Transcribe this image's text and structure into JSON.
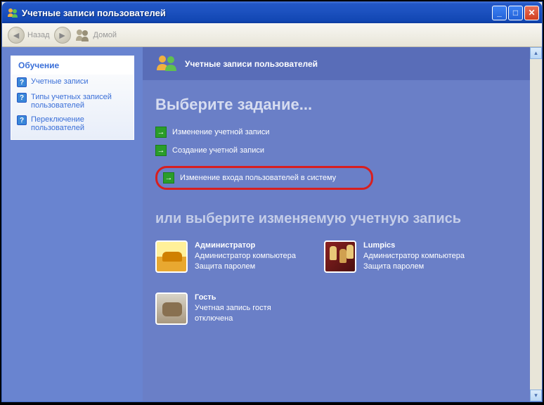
{
  "window": {
    "title": "Учетные записи пользователей"
  },
  "toolbar": {
    "back": "Назад",
    "home": "Домой"
  },
  "sidebar": {
    "header": "Обучение",
    "items": [
      "Учетные записи",
      "Типы учетных записей пользователей",
      "Переключение пользователей"
    ]
  },
  "main": {
    "header": "Учетные записи пользователей",
    "heading1": "Выберите задание...",
    "tasks": [
      "Изменение учетной записи",
      "Создание учетной записи",
      "Изменение входа пользователей в систему"
    ],
    "heading2": "или выберите изменяемую учетную запись",
    "accounts": [
      {
        "name": "Администратор",
        "role": "Администратор компьютера",
        "status": "Защита паролем"
      },
      {
        "name": "Lumpics",
        "role": "Администратор компьютера",
        "status": "Защита паролем"
      },
      {
        "name": "Гость",
        "role": "Учетная запись гостя отключена",
        "status": ""
      }
    ]
  }
}
